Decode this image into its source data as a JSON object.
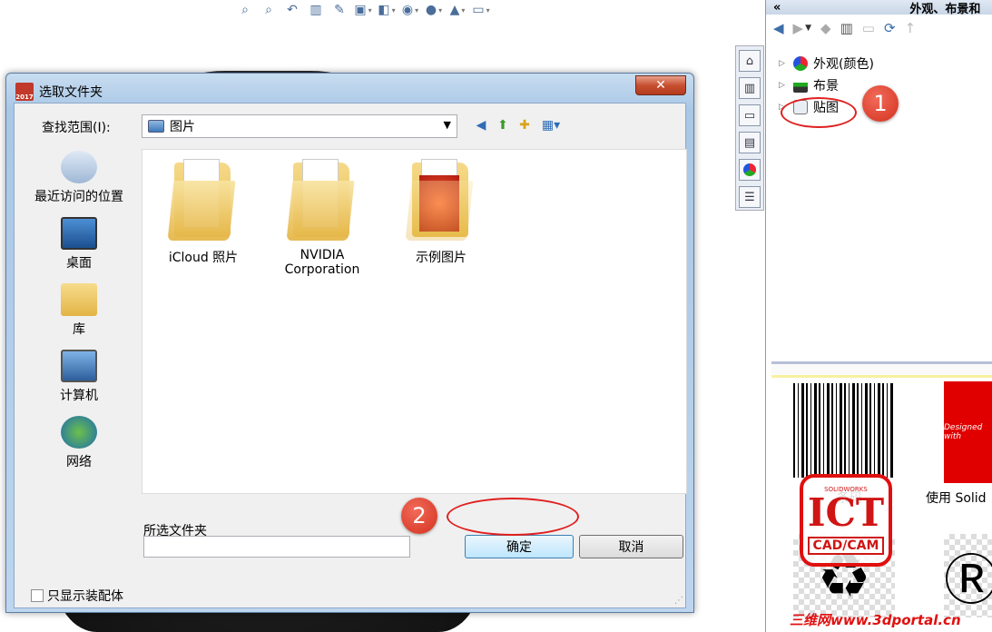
{
  "background": {
    "toolbar_icons": [
      "zoom-to-fit-icon",
      "zoom-area-icon",
      "previous-view-icon",
      "section-view-icon",
      "dynamic-annotation-icon",
      "view-orientation-icon",
      "display-style-icon",
      "hide-show-icon",
      "edit-appearance-icon",
      "apply-scene-icon",
      "view-settings-icon"
    ]
  },
  "dialog": {
    "title": "选取文件夹",
    "close_label": "✕",
    "lookin_label": "查找范围(I):",
    "lookin_value": "图片",
    "places": [
      {
        "label": "最近访问的位置"
      },
      {
        "label": "桌面"
      },
      {
        "label": "库"
      },
      {
        "label": "计算机"
      },
      {
        "label": "网络"
      }
    ],
    "folders": [
      {
        "label": "iCloud 照片"
      },
      {
        "label": "NVIDIA Corporation"
      },
      {
        "label": "示例图片"
      }
    ],
    "selected_folder_label": "所选文件夹",
    "selected_folder_value": "",
    "ok_label": "确定",
    "cancel_label": "取消",
    "checkbox_label": "只显示装配体",
    "checkbox_checked": false
  },
  "taskpane": {
    "header": "外观、布景和",
    "tree": [
      {
        "label": "外观(颜色)"
      },
      {
        "label": "布景"
      },
      {
        "label": "贴图"
      }
    ],
    "thumbnails": [
      {
        "label": "条码"
      },
      {
        "label": "使用 Solid"
      }
    ],
    "red_card_text": "Designed with"
  },
  "annotations": {
    "badge1": "1",
    "badge2": "2",
    "accent": "#d3311d"
  },
  "watermark": {
    "logo_big": "ICT",
    "logo_small": "CAD/CAM",
    "logo_top": "SOLIDWORKS",
    "url": "三维网www.3dportal.cn"
  }
}
